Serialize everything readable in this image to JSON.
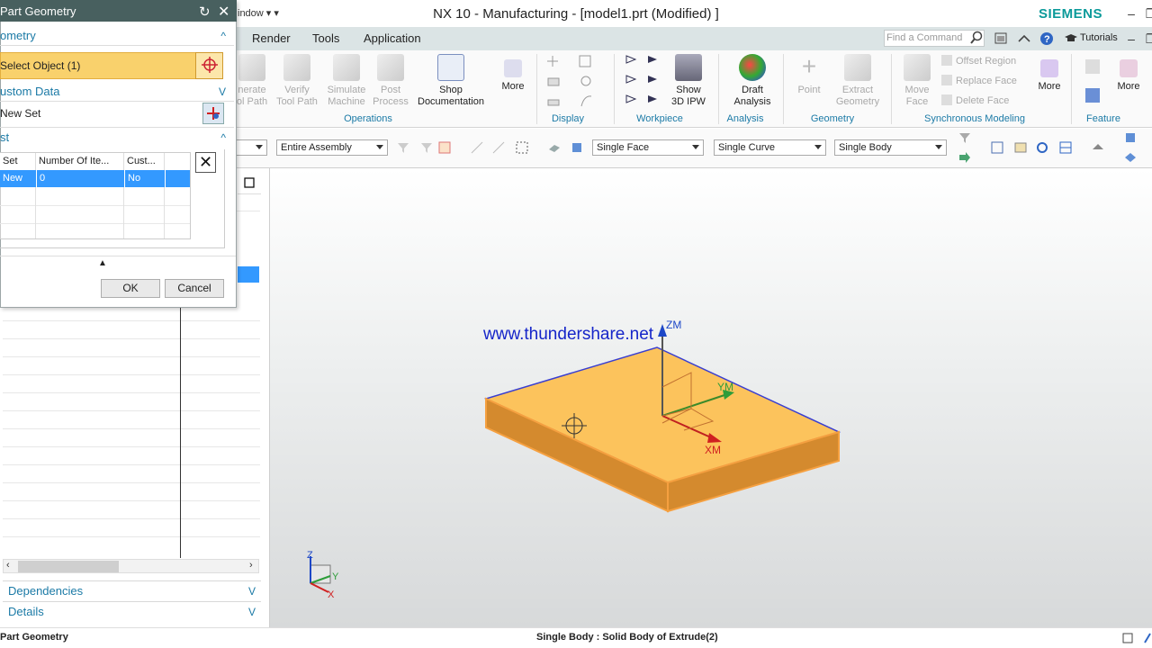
{
  "window": {
    "title": "NX 10 - Manufacturing - [model1.prt (Modified) ]",
    "brand": "SIEMENS",
    "window_menu": "indow ▾ ▾"
  },
  "menu": {
    "tabs": [
      "Render",
      "Tools",
      "Application"
    ],
    "search_placeholder": "Find a Command",
    "tutorials": "Tutorials"
  },
  "ribbon": {
    "operations": {
      "generate": "nerate\nol Path",
      "verify": "Verify\nTool Path",
      "simulate": "Simulate\nMachine",
      "post": "Post\nProcess",
      "shop_doc": "Shop\nDocumentation",
      "more": "More",
      "label": "Operations"
    },
    "display_label": "Display",
    "workpiece": {
      "show_ipw": "Show\n3D IPW",
      "label": "Workpiece"
    },
    "analysis": {
      "draft": "Draft\nAnalysis",
      "label": "Analysis"
    },
    "geometry": {
      "point": "Point",
      "extract": "Extract\nGeometry",
      "label": "Geometry"
    },
    "sync": {
      "move_face": "Move\nFace",
      "offset_region": "Offset Region",
      "replace_face": "Replace Face",
      "delete_face": "Delete Face",
      "more": "More",
      "label": "Synchronous Modeling"
    },
    "feature": {
      "more": "More",
      "label": "Feature"
    }
  },
  "selection_bar": {
    "scope": "Entire Assembly",
    "face_rule": "Single Face",
    "curve_rule": "Single Curve",
    "body_rule": "Single Body"
  },
  "dialog": {
    "title": "Part Geometry",
    "geometry_section": "ometry",
    "select_object": "Select Object (1)",
    "custom_data": "ustom Data",
    "new_set": "New Set",
    "list_section": "st",
    "columns": [
      "Set",
      "Number Of Ite...",
      "Cust..."
    ],
    "rows": [
      [
        "New",
        "0",
        "No"
      ]
    ],
    "ok": "OK",
    "cancel": "Cancel"
  },
  "nav_panel": {
    "dependencies": "Dependencies",
    "details": "Details"
  },
  "viewport": {
    "watermark": "www.thundershare.net",
    "axes": {
      "zm": "ZM",
      "ym": "YM",
      "xm": "XM"
    },
    "triad": {
      "z": "Z",
      "y": "Y",
      "x": "X"
    },
    "colors": {
      "top_face": "#fcc35c",
      "side_face": "#d48a2e",
      "edge": "#3a3fd0"
    }
  },
  "status": {
    "left": "Part Geometry",
    "center": "Single Body : Solid Body of Extrude(2)"
  }
}
